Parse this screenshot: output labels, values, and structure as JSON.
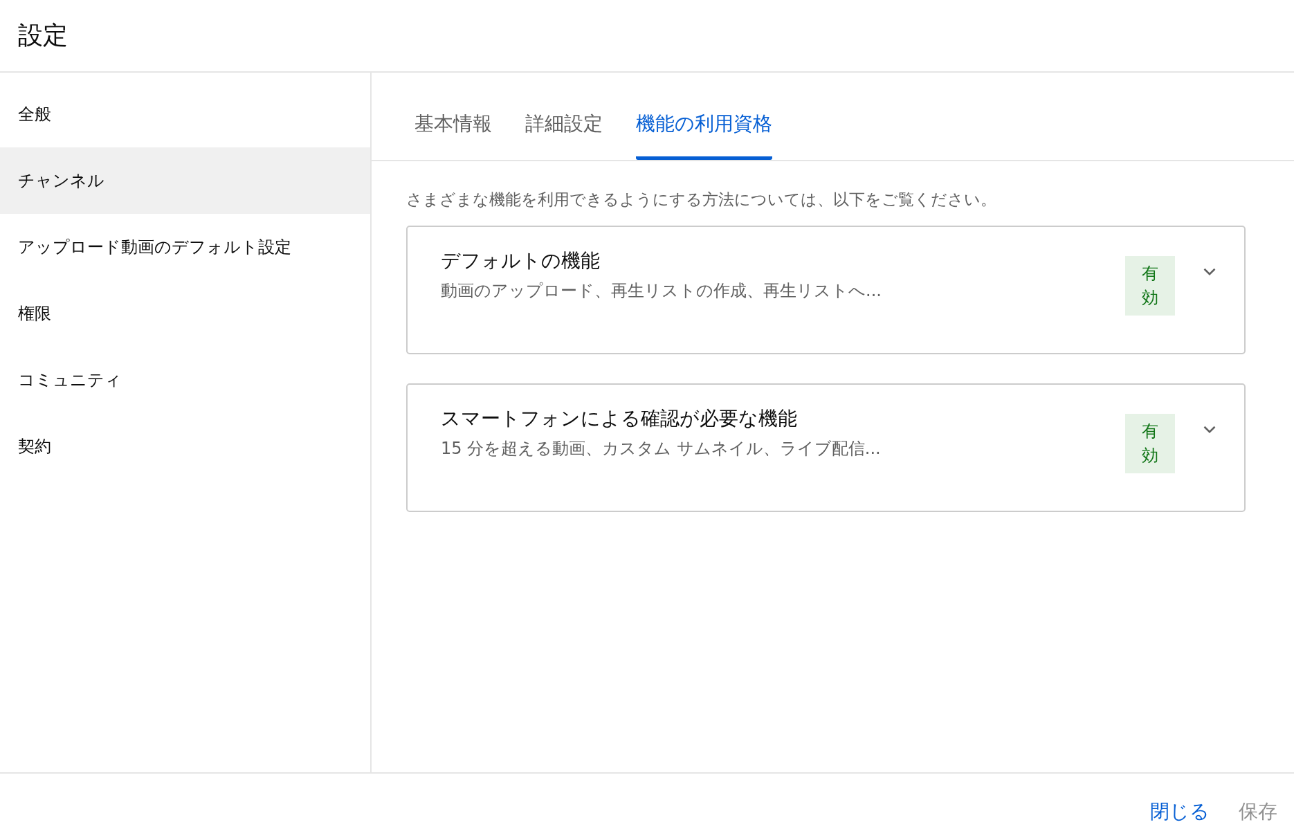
{
  "window": {
    "title": "設定"
  },
  "sidebar": {
    "items": [
      {
        "label": "全般",
        "selected": false
      },
      {
        "label": "チャンネル",
        "selected": true
      },
      {
        "label": "アップロード動画のデフォルト設定",
        "selected": false
      },
      {
        "label": "権限",
        "selected": false
      },
      {
        "label": "コミュニティ",
        "selected": false
      },
      {
        "label": "契約",
        "selected": false
      }
    ]
  },
  "tabs": [
    {
      "label": "基本情報",
      "selected": false
    },
    {
      "label": "詳細設定",
      "selected": false
    },
    {
      "label": "機能の利用資格",
      "selected": true
    }
  ],
  "intro": "さまざまな機能を利用できるようにする方法については、以下をご覧ください。",
  "sections": [
    {
      "title": "デフォルトの機能",
      "description": "動画のアップロード、再生リストの作成、再生リストへ...",
      "status": "有効",
      "expanded": false
    },
    {
      "title": "スマートフォンによる確認が必要な機能",
      "description": "15 分を超える動画、カスタム サムネイル、ライブ配信...",
      "status": "有効",
      "expanded": false
    }
  ],
  "footer": {
    "buttons": [
      {
        "label": "閉じる",
        "disabled": false
      },
      {
        "label": "保存",
        "disabled": true
      }
    ]
  }
}
